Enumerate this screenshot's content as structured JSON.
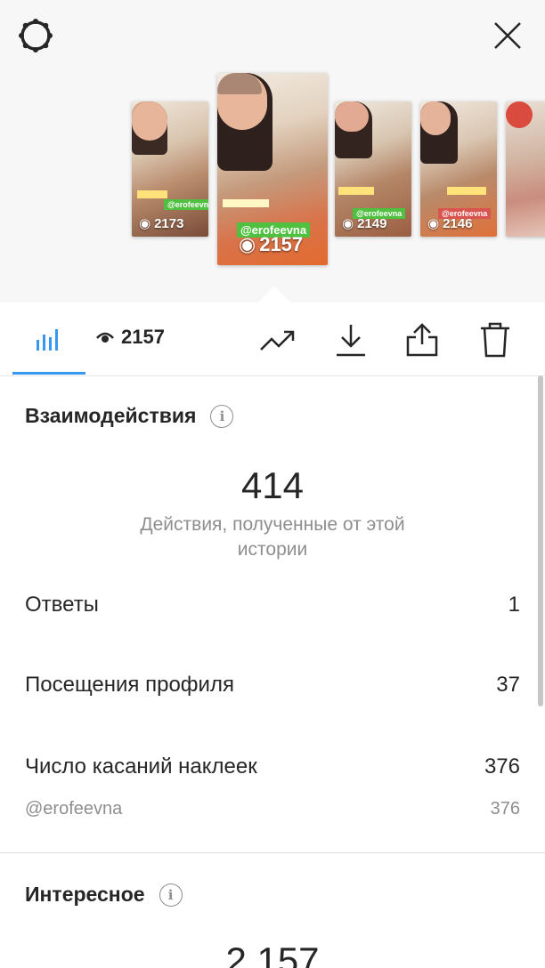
{
  "header": {
    "settings_icon": "gear-icon",
    "close_icon": "close-icon"
  },
  "stories": [
    {
      "views": "2173",
      "tag": "@erofeevna",
      "selected": false
    },
    {
      "views": "2157",
      "tag": "@erofeevna",
      "selected": true
    },
    {
      "views": "2149",
      "tag": "@erofeevna",
      "selected": false
    },
    {
      "views": "2146",
      "tag": "@erofeevna",
      "selected": false
    },
    {
      "views": "",
      "tag": "",
      "selected": false
    }
  ],
  "toolbar": {
    "views_count": "2157",
    "icons": [
      "bar-chart-icon",
      "eye-icon",
      "trend-icon",
      "download-icon",
      "share-icon",
      "trash-icon"
    ],
    "accent_color": "#3897f0"
  },
  "interactions": {
    "title": "Взаимодействия",
    "total": "414",
    "subtitle": "Действия, полученные от этой истории",
    "rows": [
      {
        "label": "Ответы",
        "value": "1"
      },
      {
        "label": "Посещения профиля",
        "value": "37"
      },
      {
        "label": "Число касаний наклеек",
        "value": "376"
      }
    ],
    "sticker_sub": {
      "label": "@erofeevna",
      "value": "376"
    }
  },
  "discovery": {
    "title": "Интересное",
    "total": "2 157"
  }
}
